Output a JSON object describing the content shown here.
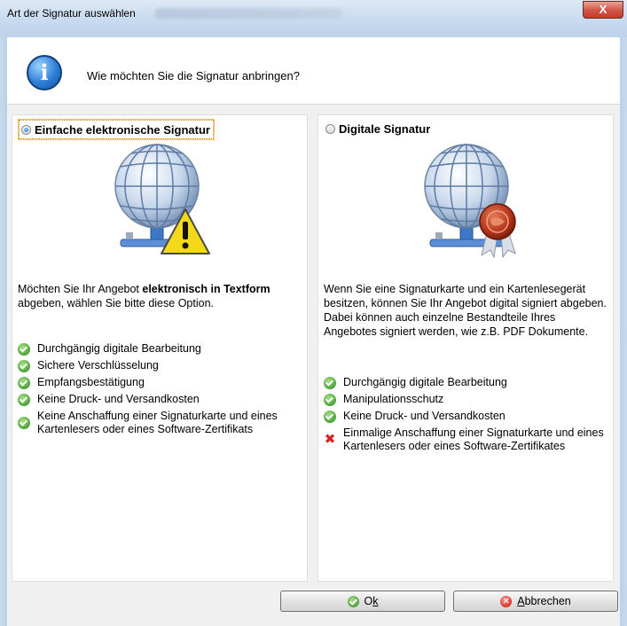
{
  "window": {
    "title": "Art der Signatur auswählen",
    "close_glyph": "X"
  },
  "header": {
    "icon": "info-icon",
    "question": "Wie möchten Sie die Signatur anbringen?"
  },
  "left_panel": {
    "option_label": "Einfache elektronische Signatur",
    "selected": true,
    "illustration": "globe-warning-icon",
    "description_parts": {
      "pre": "Möchten Sie Ihr Angebot ",
      "bold": "elektronisch in Textform",
      "post": " abgeben, wählen Sie bitte diese Option."
    },
    "features": [
      {
        "icon": "check-icon",
        "text": "Durchgängig digitale Bearbeitung"
      },
      {
        "icon": "check-icon",
        "text": "Sichere Verschlüsselung"
      },
      {
        "icon": "check-icon",
        "text": "Empfangsbestätigung"
      },
      {
        "icon": "check-icon",
        "text": "Keine Druck- und Versandkosten"
      },
      {
        "icon": "check-icon",
        "text": "Keine Anschaffung einer Signaturkarte und eines Kartenlesers oder eines Software-Zertifikats"
      }
    ]
  },
  "right_panel": {
    "option_label": "Digitale Signatur",
    "selected": false,
    "illustration": "globe-seal-icon",
    "description": "Wenn Sie eine Signaturkarte und ein Kartenlesegerät besitzen, können Sie Ihr Angebot digital signiert abgeben. Dabei können auch einzelne Bestandteile Ihres Angebotes signiert werden, wie z.B. PDF Dokumente.",
    "features": [
      {
        "icon": "check-icon",
        "text": "Durchgängig digitale Bearbeitung"
      },
      {
        "icon": "check-icon",
        "text": "Manipulationsschutz"
      },
      {
        "icon": "check-icon",
        "text": "Keine Druck- und Versandkosten"
      },
      {
        "icon": "x-icon",
        "text": "Einmalige Anschaffung einer Signaturkarte und eines Kartenlesers oder eines Software-Zertifikates"
      }
    ]
  },
  "buttons": {
    "ok_prefix": "O",
    "ok_accel": "k",
    "cancel_accel": "A",
    "cancel_rest": "bbrechen"
  }
}
